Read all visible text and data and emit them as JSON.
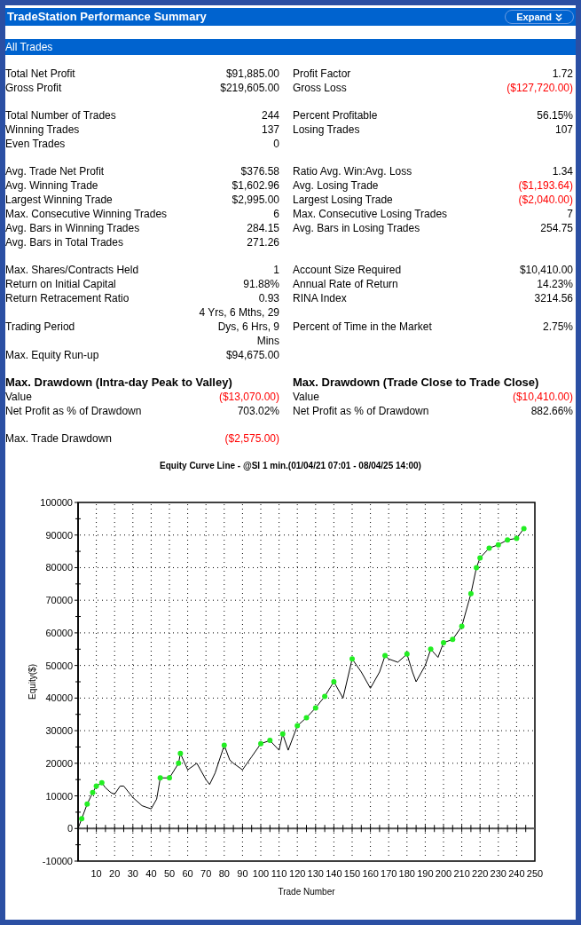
{
  "window": {
    "title": "TradeStation Performance Summary",
    "expand_button": "Expand"
  },
  "section_title": "All Trades",
  "stat_groups": [
    {
      "rows": [
        {
          "left": {
            "label": "Total Net Profit",
            "value": "$91,885.00",
            "negative": false
          },
          "right": {
            "label": "Profit Factor",
            "value": "1.72",
            "negative": false
          }
        },
        {
          "left": {
            "label": "Gross Profit",
            "value": "$219,605.00",
            "negative": false
          },
          "right": {
            "label": "Gross Loss",
            "value": "($127,720.00)",
            "negative": true
          }
        }
      ]
    },
    {
      "rows": [
        {
          "left": {
            "label": "Total Number of Trades",
            "value": "244",
            "negative": false
          },
          "right": {
            "label": "Percent Profitable",
            "value": "56.15%",
            "negative": false
          }
        },
        {
          "left": {
            "label": "Winning Trades",
            "value": "137",
            "negative": false
          },
          "right": {
            "label": "Losing Trades",
            "value": "107",
            "negative": false
          }
        },
        {
          "left": {
            "label": "Even Trades",
            "value": "0",
            "negative": false
          }
        }
      ]
    },
    {
      "rows": [
        {
          "left": {
            "label": "Avg. Trade Net Profit",
            "value": "$376.58",
            "negative": false
          },
          "right": {
            "label": "Ratio Avg. Win:Avg. Loss",
            "value": "1.34",
            "negative": false
          }
        },
        {
          "left": {
            "label": "Avg. Winning Trade",
            "value": "$1,602.96",
            "negative": false
          },
          "right": {
            "label": "Avg. Losing Trade",
            "value": "($1,193.64)",
            "negative": true
          }
        },
        {
          "left": {
            "label": "Largest Winning Trade",
            "value": "$2,995.00",
            "negative": false
          },
          "right": {
            "label": "Largest Losing Trade",
            "value": "($2,040.00)",
            "negative": true
          }
        },
        {
          "left": {
            "label": "Max. Consecutive Winning Trades",
            "value": "6",
            "negative": false
          },
          "right": {
            "label": "Max. Consecutive Losing Trades",
            "value": "7",
            "negative": false
          }
        },
        {
          "left": {
            "label": "Avg. Bars in Winning Trades",
            "value": "284.15",
            "negative": false
          },
          "right": {
            "label": "Avg. Bars in Losing Trades",
            "value": "254.75",
            "negative": false
          }
        },
        {
          "left": {
            "label": "Avg. Bars in Total Trades",
            "value": "271.26",
            "negative": false
          }
        }
      ]
    },
    {
      "rows": [
        {
          "left": {
            "label": "Max. Shares/Contracts Held",
            "value": "1",
            "negative": false
          },
          "right": {
            "label": "Account Size Required",
            "value": "$10,410.00",
            "negative": false
          }
        },
        {
          "left": {
            "label": "Return on Initial Capital",
            "value": "91.88%",
            "negative": false
          },
          "right": {
            "label": "Annual Rate of Return",
            "value": "14.23%",
            "negative": false
          }
        },
        {
          "left": {
            "label": "Return Retracement Ratio",
            "value": "0.93",
            "negative": false
          },
          "right": {
            "label": "RINA Index",
            "value": "3214.56",
            "negative": false
          }
        },
        {
          "left": {
            "label": "Trading Period",
            "value": "4 Yrs, 6 Mths, 29 Dys, 6 Hrs, 9 Mins",
            "negative": false
          },
          "right": {
            "label": "Percent of Time in the Market",
            "value": "2.75%",
            "negative": false
          }
        },
        {
          "left": {
            "label": "Max. Equity Run-up",
            "value": "$94,675.00",
            "negative": false
          }
        }
      ]
    }
  ],
  "drawdowns": [
    {
      "heading": "Max. Drawdown (Intra-day Peak to Valley)",
      "rows": [
        {
          "label": "Value",
          "value": "($13,070.00)",
          "negative": true
        },
        {
          "label": "Net Profit as % of Drawdown",
          "value": "703.02%",
          "negative": false
        }
      ]
    },
    {
      "heading": "Max. Drawdown (Trade Close to Trade Close)",
      "rows": [
        {
          "label": "Value",
          "value": "($10,410.00)",
          "negative": true
        },
        {
          "label": "Net Profit as % of Drawdown",
          "value": "882.66%",
          "negative": false
        }
      ]
    }
  ],
  "max_trade_drawdown": {
    "label": "Max. Trade Drawdown",
    "value": "($2,575.00)",
    "negative": true
  },
  "chart": {
    "chart_data": {
      "type": "line",
      "title": "Equity Curve Line - @SI 1 min.(01/04/21 07:01 - 08/04/25 14:00)",
      "xlabel": "Trade Number",
      "ylabel": "Equity($)",
      "x": [
        0,
        2,
        5,
        8,
        10,
        13,
        15,
        18,
        20,
        23,
        25,
        30,
        35,
        40,
        43,
        45,
        50,
        55,
        56,
        60,
        65,
        70,
        72,
        75,
        80,
        83,
        85,
        90,
        95,
        100,
        105,
        110,
        112,
        115,
        120,
        125,
        130,
        135,
        140,
        145,
        150,
        155,
        160,
        165,
        168,
        170,
        175,
        180,
        183,
        185,
        190,
        193,
        197,
        200,
        205,
        210,
        215,
        218,
        220,
        225,
        230,
        235,
        240,
        244
      ],
      "grid": true,
      "series": [
        {
          "color": "#000000",
          "values": [
            0,
            3000,
            7500,
            11000,
            13000,
            14000,
            12500,
            11000,
            10500,
            13000,
            13000,
            9500,
            7000,
            6000,
            9000,
            15500,
            15500,
            20000,
            23000,
            18000,
            20000,
            15000,
            13500,
            17000,
            25500,
            21000,
            20000,
            18000,
            22000,
            26000,
            27000,
            24000,
            29000,
            24000,
            31500,
            34000,
            37000,
            40500,
            45000,
            40000,
            52000,
            48000,
            43000,
            48000,
            53000,
            52000,
            51000,
            53500,
            48000,
            45000,
            50000,
            55000,
            52500,
            57000,
            58000,
            62000,
            72000,
            80000,
            83000,
            86000,
            87000,
            88500,
            89000,
            92000
          ]
        }
      ],
      "xlim": [
        0,
        250
      ],
      "ylim": [
        -10000,
        100000
      ],
      "xticks": [
        10,
        20,
        30,
        40,
        50,
        60,
        70,
        80,
        90,
        100,
        110,
        120,
        130,
        140,
        150,
        160,
        170,
        180,
        190,
        200,
        210,
        220,
        230,
        240,
        250
      ],
      "yticks": [
        -10000,
        0,
        10000,
        20000,
        30000,
        40000,
        50000,
        60000,
        70000,
        80000,
        90000,
        100000
      ]
    }
  }
}
